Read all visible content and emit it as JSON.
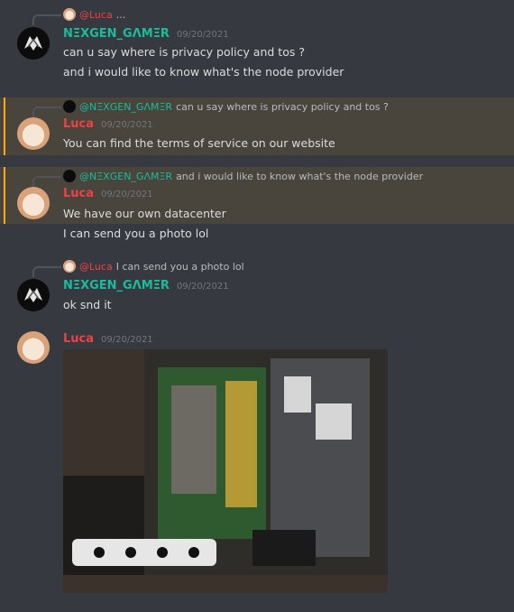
{
  "users": {
    "nexgen": {
      "name": "NΞXGEN_GΛMΞR",
      "color": "#1abc9c"
    },
    "luca": {
      "name": "Luca",
      "color": "#ed4245"
    }
  },
  "messages": [
    {
      "reply": {
        "name": "@Luca",
        "text": "..."
      },
      "author": "NΞXGEN_GΛMΞR",
      "time": "09/20/2021",
      "lines": [
        "can u say where is privacy policy and tos ?",
        "and i would like to know what's the node provider"
      ]
    },
    {
      "reply": {
        "name": "@NΞXGEN_GΛMΞR",
        "text": "can u say where is privacy policy and tos ?"
      },
      "author": "Luca",
      "time": "09/20/2021",
      "lines": [
        "You can find the terms of service on our website"
      ]
    },
    {
      "reply": {
        "name": "@NΞXGEN_GΛMΞR",
        "text": "and i would like to know what's the node provider"
      },
      "author": "Luca",
      "time": "09/20/2021",
      "lines": [
        "We have our own datacenter",
        "I can send you a photo lol"
      ]
    },
    {
      "reply": {
        "name": "@Luca",
        "text": "I can send you a photo lol"
      },
      "author": "NΞXGEN_GΛMΞR",
      "time": "09/20/2021",
      "lines": [
        "ok snd it"
      ]
    },
    {
      "author": "Luca",
      "time": "09/20/2021",
      "attachment": "server-photo"
    }
  ],
  "theme": {
    "mention_bg": "#49443c",
    "mention_bar": "#faa81a",
    "bg": "#36393f"
  }
}
